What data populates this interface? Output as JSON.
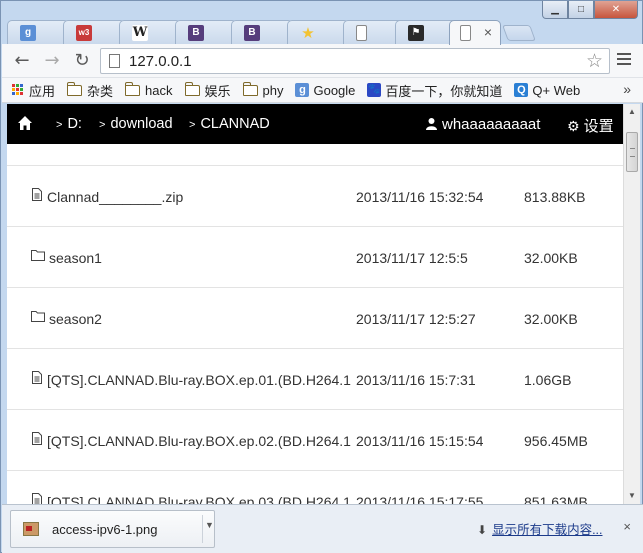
{
  "browser": {
    "tabs": [
      {
        "icon": "google-favicon",
        "color": "#5b8fd6",
        "glyph": "g"
      },
      {
        "icon": "w3schools-favicon",
        "color": "#c83a3a",
        "glyph": "w3"
      },
      {
        "icon": "wikipedia-favicon",
        "color": "#ffffff",
        "glyph": "W"
      },
      {
        "icon": "bootstrap-favicon",
        "color": "#563d7c",
        "glyph": "B"
      },
      {
        "icon": "bootstrap-favicon",
        "color": "#563d7c",
        "glyph": "B"
      },
      {
        "icon": "star-favicon",
        "color": "#f3c332",
        "glyph": "★"
      },
      {
        "icon": "page-favicon",
        "color": "#ffffff",
        "glyph": ""
      },
      {
        "icon": "flag-favicon",
        "color": "#2a2a2a",
        "glyph": "⚑"
      }
    ],
    "active_tab": {
      "icon": "page-favicon",
      "close": "×"
    },
    "window_controls": {
      "minimize": "▁",
      "maximize": "□",
      "close": "✕"
    },
    "nav": {
      "back": "←",
      "forward": "→",
      "reload": "↻"
    },
    "address": "127.0.0.1",
    "bookmark_star": "☆",
    "bookmarks": [
      {
        "label": "应用",
        "kind": "apps"
      },
      {
        "label": "杂类",
        "kind": "folder"
      },
      {
        "label": "hack",
        "kind": "folder"
      },
      {
        "label": "娱乐",
        "kind": "folder"
      },
      {
        "label": "phy",
        "kind": "folder"
      },
      {
        "label": "Google",
        "kind": "google"
      },
      {
        "label": "百度一下，你就知道",
        "kind": "baidu"
      },
      {
        "label": "Q+ Web",
        "kind": "qplus"
      }
    ],
    "bookmarks_more": "»"
  },
  "site": {
    "breadcrumbs": [
      "D:",
      "download",
      "CLANNAD"
    ],
    "user": "whaaaaaaaaat",
    "settings_label": "设置",
    "files": [
      {
        "type": "file",
        "name": "Clannad________.zip",
        "date": "2013/11/16 15:32:54",
        "size": "813.88KB"
      },
      {
        "type": "folder",
        "name": "season1",
        "date": "2013/11/17 12:5:5",
        "size": "32.00KB"
      },
      {
        "type": "folder",
        "name": "season2",
        "date": "2013/11/17 12:5:27",
        "size": "32.00KB"
      },
      {
        "type": "file",
        "name": "[QTS].CLANNAD.Blu-ray.BOX.ep.01.(BD.H264.1",
        "date": "2013/11/16 15:7:31",
        "size": "1.06GB"
      },
      {
        "type": "file",
        "name": "[QTS].CLANNAD.Blu-ray.BOX.ep.02.(BD.H264.1",
        "date": "2013/11/16 15:15:54",
        "size": "956.45MB"
      },
      {
        "type": "file",
        "name": "[QTS].CLANNAD.Blu-ray.BOX.ep.03.(BD.H264.1",
        "date": "2013/11/16 15:17:55",
        "size": "851.63MB"
      }
    ]
  },
  "downloads": {
    "file_name": "access-ipv6-1.png",
    "show_all": "显示所有下载内容...",
    "close": "×"
  }
}
